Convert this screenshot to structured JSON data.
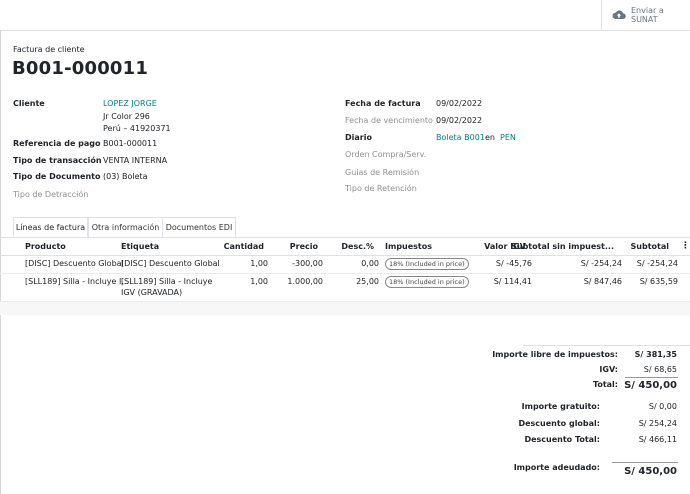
{
  "topbar": {
    "sunat_button": "Enviar a\nSUNAT",
    "icon": "cloud-upload-icon"
  },
  "header": {
    "subtitle": "Factura de cliente",
    "number": "B001-000011"
  },
  "left_fields": {
    "cliente_label": "Cliente",
    "cliente_name": "LOPEZ JORGE",
    "cliente_addr1": "Jr Color 296",
    "cliente_addr2": "Perú – 41920371",
    "ref_label": "Referencia de pago",
    "ref_value": "B001-000011",
    "tipo_trans_label": "Tipo de transacción",
    "tipo_trans_value": "VENTA INTERNA",
    "tipo_doc_label": "Tipo de Documento",
    "tipo_doc_value": "(03) Boleta",
    "detraccion_label": "Tipo de Detracción"
  },
  "right_fields": {
    "fecha_label": "Fecha de factura",
    "fecha_value": "09/02/2022",
    "venc_label": "Fecha de vencimiento",
    "venc_value": "09/02/2022",
    "diario_label": "Diario",
    "diario_value": "Boleta B001",
    "en_text": "en",
    "currency": "PEN",
    "orden_label": "Orden Compra/Serv.",
    "guias_label": "Guias de Remisión",
    "retencion_label": "Tipo de Retención"
  },
  "tabs": [
    "Líneas de factura",
    "Otra información",
    "Documentos EDI"
  ],
  "table": {
    "headers": [
      "Producto",
      "Etiqueta",
      "Cantidad",
      "Precio",
      "Desc.%",
      "Impuestos",
      "Valor IGV",
      "Subtotal sin impuest...",
      "Subtotal"
    ],
    "rows": [
      {
        "producto": "[DISC] Descuento Global",
        "etiqueta": "[DISC] Descuento Global",
        "etiqueta2": "",
        "cantidad": "1,00",
        "precio": "-300,00",
        "desc": "0,00",
        "impuestos": "18% (Included in price)",
        "valor_igv": "S/ -45,76",
        "subtotal_sin": "S/ -254,24",
        "subtotal": "S/ -254,24"
      },
      {
        "producto": "[SLL189] Silla - Incluye I...",
        "etiqueta": "[SLL189] Silla - Incluye",
        "etiqueta2": "IGV (GRAVADA)",
        "cantidad": "1,00",
        "precio": "1.000,00",
        "desc": "25,00",
        "impuestos": "18% (Included in price)",
        "valor_igv": "S/ 114,41",
        "subtotal_sin": "S/ 847,46",
        "subtotal": "S/ 635,59"
      }
    ]
  },
  "totals": {
    "libre_label": "Importe libre de impuestos:",
    "libre_value": "S/ 381,35",
    "igv_label": "IGV:",
    "igv_value": "S/ 68,65",
    "total_label": "Total:",
    "total_value": "S/ 450,00",
    "gratuito_label": "Importe gratuito:",
    "gratuito_value": "S/ 0,00",
    "desc_global_label": "Descuento global:",
    "desc_global_value": "S/ 254,24",
    "desc_total_label": "Descuento Total:",
    "desc_total_value": "S/ 466,11",
    "adeudado_label": "Importe adeudado:",
    "adeudado_value": "S/ 450,00"
  }
}
